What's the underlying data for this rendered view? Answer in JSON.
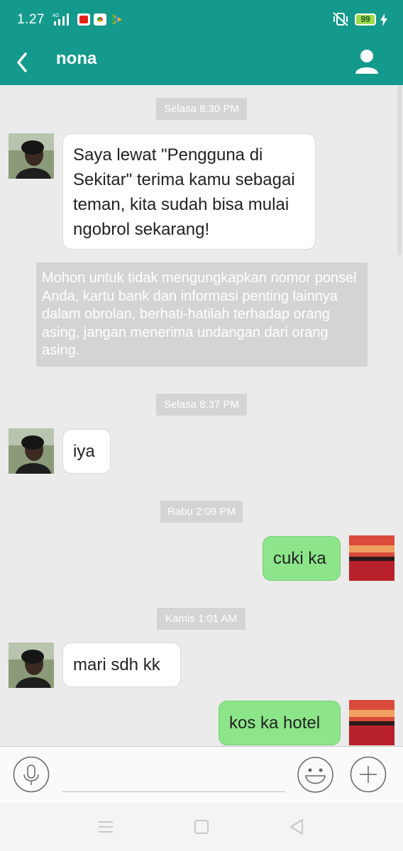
{
  "status_bar": {
    "time": "1.27",
    "battery": "99",
    "icons": [
      "signal-icon",
      "youtube-icon",
      "chrome-icon",
      "play-games-icon",
      "vibrate-icon",
      "battery-icon",
      "charging-icon"
    ]
  },
  "header": {
    "title": "nona",
    "icons": [
      "back-arrow-icon",
      "profile-icon"
    ]
  },
  "messages": {
    "ts1": "Selasa 8:30 PM",
    "m1": "Saya lewat \"Pengguna di Sekitar\" terima kamu sebagai teman, kita sudah bisa mulai ngobrol sekarang!",
    "warning": "Mohon untuk tidak  mengungkapkan nomor ponsel Anda, kartu bank dan informasi penting lainnya dalam obrolan, berhati-hatilah terhadap orang asing, jangan menerima undangan dari orang asing.",
    "ts2": "Selasa 8:37 PM",
    "m2": "iya",
    "ts3": "Rabu 2:09 PM",
    "m3": "cuki ka",
    "ts4": "Kamis 1:01 AM",
    "m4": "mari sdh kk",
    "m5": "kos ka hotel"
  },
  "input_bar": {
    "value": "",
    "icons": [
      "microphone-icon",
      "emoji-icon",
      "plus-icon"
    ]
  },
  "nav_bar": {
    "icons": [
      "menu-icon",
      "home-icon",
      "back-icon"
    ]
  },
  "colors": {
    "header": "#139a8c",
    "outgoing_bubble": "#8de58a",
    "incoming_bubble": "#ffffff",
    "chat_background": "#ebebeb",
    "timestamp_pill": "#d4d4d4"
  }
}
